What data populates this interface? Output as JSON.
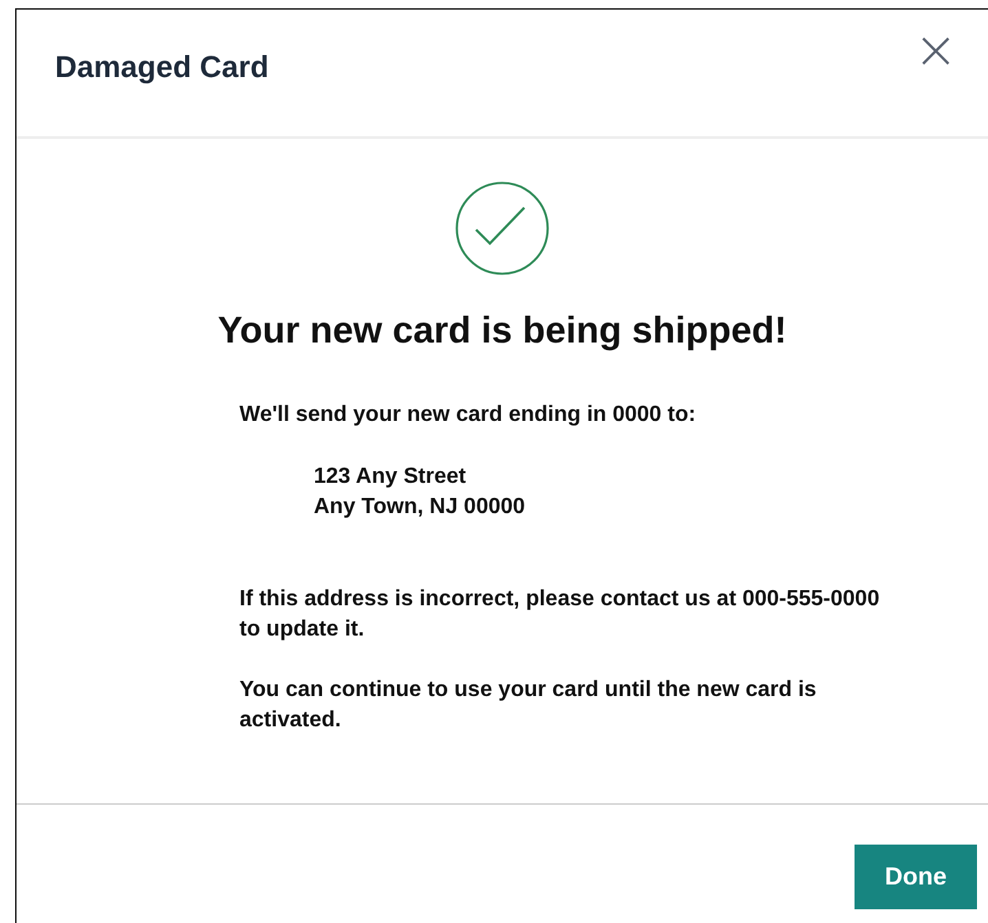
{
  "dialog": {
    "title": "Damaged Card",
    "close": "×"
  },
  "body": {
    "heading": "Your new card is being shipped!",
    "intro": "We'll send your new card ending in 0000 to:",
    "address": [
      "123 Any Street",
      "Any Town, NJ 00000"
    ],
    "paragraphs": [
      "If this address is incorrect, please contact us at 000-555-0000 to update it.",
      "You can continue to use your card until the new card is activated."
    ]
  },
  "buttons": [
    "Done"
  ]
}
